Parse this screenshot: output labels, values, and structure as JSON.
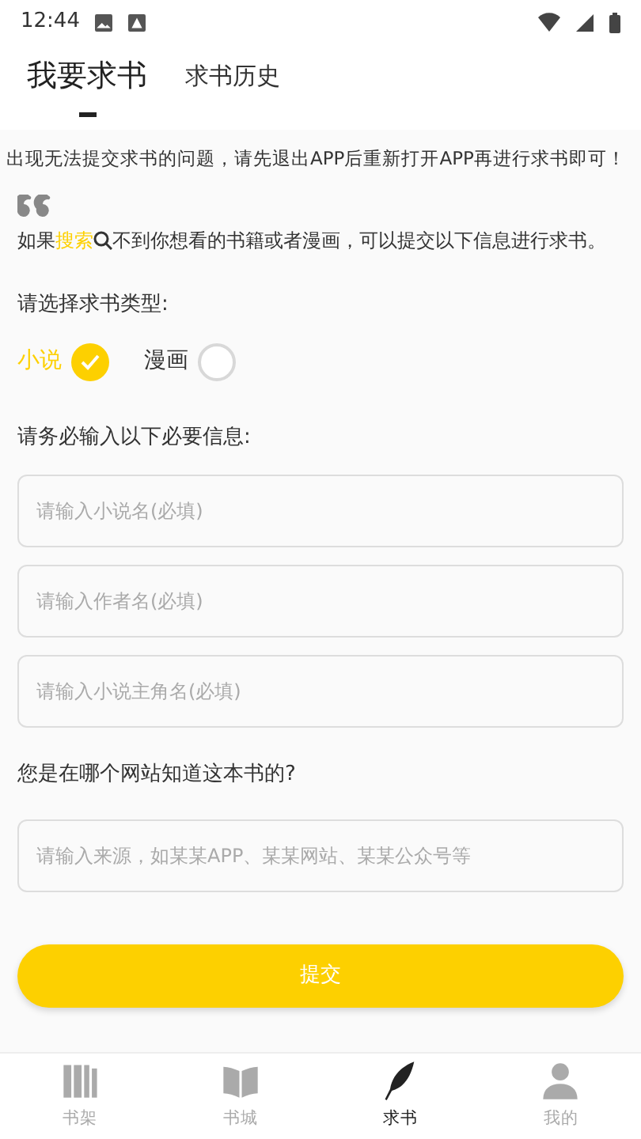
{
  "status_bar": {
    "time": "12:44"
  },
  "tabs": [
    {
      "label": "我要求书",
      "selected": true
    },
    {
      "label": "求书历史",
      "selected": false
    }
  ],
  "notice": "出现无法提交求书的问题，请先退出APP后重新打开APP再进行求书即可！",
  "intro": {
    "before": "如果",
    "link": "搜索",
    "after": "不到你想看的书籍或者漫画，可以提交以下信息进行求书。"
  },
  "type_label": "请选择求书类型:",
  "types": [
    {
      "label": "小说",
      "selected": true
    },
    {
      "label": "漫画",
      "selected": false
    }
  ],
  "required_label": "请务必输入以下必要信息:",
  "required_fields": [
    {
      "placeholder": "请输入小说名(必填)"
    },
    {
      "placeholder": "请输入作者名(必填)"
    },
    {
      "placeholder": "请输入小说主角名(必填)"
    }
  ],
  "source_label": "您是在哪个网站知道这本书的?",
  "source_field": {
    "placeholder": "请输入来源，如某某APP、某某网站、某某公众号等"
  },
  "submit": "提交",
  "nav": [
    {
      "kind": "shelf",
      "label": "书架",
      "selected": false
    },
    {
      "kind": "store",
      "label": "书城",
      "selected": false
    },
    {
      "kind": "request",
      "label": "求书",
      "selected": true
    },
    {
      "kind": "profile",
      "label": "我的",
      "selected": false
    }
  ]
}
